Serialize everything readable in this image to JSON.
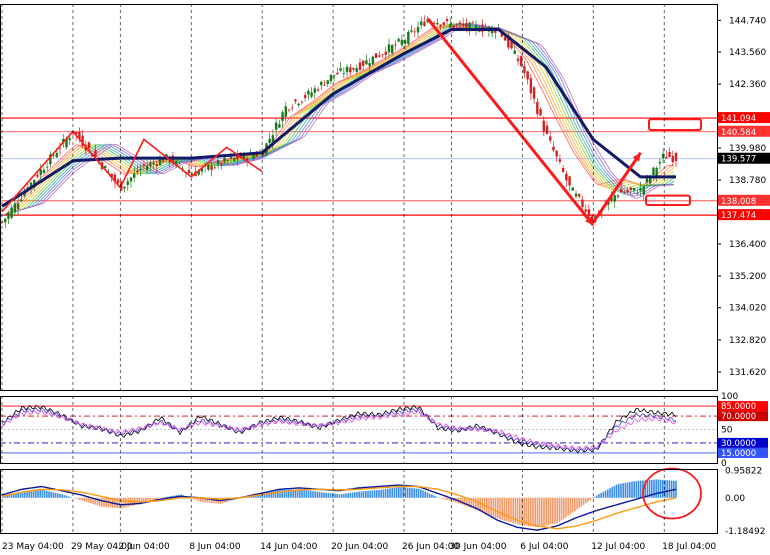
{
  "chart_data": [
    {
      "type": "line",
      "panel": "price",
      "title": "",
      "xlabel": "",
      "ylabel": "",
      "ylim": [
        130.95,
        145.35
      ],
      "y_ticks": [
        "144.740",
        "143.560",
        "142.360",
        "139.980",
        "138.780",
        "136.400",
        "135.200",
        "134.020",
        "132.820",
        "131.620"
      ],
      "price_marker": "139.577",
      "levels": [
        {
          "value": 141.094,
          "label": "141.094",
          "color": "#ff0000"
        },
        {
          "value": 140.584,
          "label": "140.584",
          "color": "#ff3030"
        },
        {
          "value": 138.008,
          "label": "138.008",
          "color": "#ff3030"
        },
        {
          "value": 137.474,
          "label": "137.474",
          "color": "#ff0000"
        }
      ],
      "close_series": [
        {
          "x": "23 May",
          "y": 137.2
        },
        {
          "x": "26 May",
          "y": 139.0
        },
        {
          "x": "29 May",
          "y": 140.6
        },
        {
          "x": "31 May",
          "y": 139.6
        },
        {
          "x": "2 Jun",
          "y": 138.5
        },
        {
          "x": "4 Jun",
          "y": 139.3
        },
        {
          "x": "6 Jun",
          "y": 139.6
        },
        {
          "x": "8 Jun",
          "y": 139.0
        },
        {
          "x": "11 Jun",
          "y": 139.5
        },
        {
          "x": "14 Jun",
          "y": 139.8
        },
        {
          "x": "16 Jun",
          "y": 141.5
        },
        {
          "x": "18 Jun",
          "y": 142.0
        },
        {
          "x": "20 Jun",
          "y": 142.7
        },
        {
          "x": "22 Jun",
          "y": 143.0
        },
        {
          "x": "26 Jun",
          "y": 144.0
        },
        {
          "x": "28 Jun",
          "y": 144.8
        },
        {
          "x": "30 Jun",
          "y": 144.55
        },
        {
          "x": "4 Jul",
          "y": 144.4
        },
        {
          "x": "6 Jul",
          "y": 143.0
        },
        {
          "x": "8 Jul",
          "y": 140.5
        },
        {
          "x": "10 Jul",
          "y": 138.5
        },
        {
          "x": "12 Jul",
          "y": 137.3
        },
        {
          "x": "14 Jul",
          "y": 138.3
        },
        {
          "x": "16 Jul",
          "y": 138.4
        },
        {
          "x": "18 Jul",
          "y": 139.7
        },
        {
          "x": "19 Jul",
          "y": 139.6
        }
      ],
      "ma_series": [
        {
          "x": "23 May",
          "y": 137.8
        },
        {
          "x": "29 May",
          "y": 139.5
        },
        {
          "x": "2 Jun",
          "y": 139.6
        },
        {
          "x": "8 Jun",
          "y": 139.6
        },
        {
          "x": "14 Jun",
          "y": 139.8
        },
        {
          "x": "20 Jun",
          "y": 142.0
        },
        {
          "x": "26 Jun",
          "y": 143.5
        },
        {
          "x": "30 Jun",
          "y": 144.4
        },
        {
          "x": "4 Jul",
          "y": 144.4
        },
        {
          "x": "8 Jul",
          "y": 143.0
        },
        {
          "x": "12 Jul",
          "y": 140.3
        },
        {
          "x": "16 Jul",
          "y": 138.9
        },
        {
          "x": "19 Jul",
          "y": 138.9
        }
      ]
    },
    {
      "type": "line",
      "panel": "oscillator",
      "title": "",
      "ylim": [
        0,
        100
      ],
      "levels": [
        {
          "value": 85,
          "label": "85.0000",
          "color": "#ff0000"
        },
        {
          "value": 70,
          "label": "70.0000",
          "color": "#cc0000"
        },
        {
          "value": 30,
          "label": "30.0000",
          "color": "#0000cc"
        },
        {
          "value": 15,
          "label": "15.0000",
          "color": "#3355ff"
        }
      ],
      "y_ticks": [
        "100",
        "50",
        "0"
      ],
      "series": [
        {
          "values": [
            60,
            82,
            84,
            72,
            55,
            52,
            40,
            48,
            68,
            45,
            70,
            58,
            45,
            60,
            68,
            62,
            52,
            64,
            74,
            72,
            80,
            84,
            52,
            48,
            56,
            44,
            30,
            24,
            22,
            18,
            20,
            62,
            80,
            75,
            72
          ]
        },
        {
          "values": [
            58,
            78,
            80,
            70,
            57,
            50,
            44,
            50,
            62,
            48,
            64,
            56,
            48,
            58,
            64,
            60,
            55,
            62,
            70,
            70,
            76,
            80,
            56,
            50,
            52,
            46,
            34,
            28,
            24,
            20,
            22,
            55,
            72,
            70,
            64
          ]
        },
        {
          "values": [
            56,
            74,
            76,
            68,
            58,
            52,
            46,
            52,
            60,
            50,
            60,
            55,
            50,
            56,
            62,
            58,
            56,
            60,
            66,
            68,
            72,
            76,
            58,
            52,
            50,
            48,
            38,
            30,
            26,
            22,
            24,
            48,
            64,
            66,
            60
          ]
        }
      ]
    },
    {
      "type": "bar",
      "panel": "macd",
      "title": "",
      "ylim": [
        -1.25,
        1.02
      ],
      "y_ticks": [
        "0.95822",
        "0.00",
        "-1.18492"
      ],
      "histogram": [
        0.05,
        0.18,
        0.28,
        0.12,
        -0.1,
        -0.32,
        -0.38,
        -0.2,
        0.0,
        0.12,
        -0.15,
        -0.22,
        0.0,
        0.15,
        0.28,
        0.3,
        0.2,
        0.12,
        0.22,
        0.28,
        0.38,
        0.32,
        0.0,
        -0.2,
        -0.45,
        -0.75,
        -0.95,
        -1.05,
        -0.9,
        -0.4,
        0.1,
        0.48,
        0.6,
        0.65,
        0.6
      ],
      "series": [
        {
          "values": [
            0.1,
            0.3,
            0.4,
            0.25,
            0.1,
            -0.1,
            -0.25,
            -0.2,
            -0.05,
            0.05,
            0.0,
            -0.1,
            0.0,
            0.15,
            0.3,
            0.35,
            0.3,
            0.25,
            0.35,
            0.4,
            0.45,
            0.4,
            0.15,
            -0.1,
            -0.4,
            -0.8,
            -1.05,
            -1.15,
            -1.0,
            -0.7,
            -0.45,
            -0.25,
            -0.05,
            0.15,
            0.3
          ]
        },
        {
          "values": [
            0.05,
            0.2,
            0.3,
            0.28,
            0.2,
            0.05,
            -0.1,
            -0.15,
            -0.1,
            0.0,
            0.0,
            -0.05,
            0.0,
            0.1,
            0.2,
            0.28,
            0.3,
            0.28,
            0.3,
            0.35,
            0.4,
            0.4,
            0.3,
            0.1,
            -0.15,
            -0.5,
            -0.8,
            -1.0,
            -1.1,
            -1.0,
            -0.8,
            -0.55,
            -0.35,
            -0.15,
            0.0
          ]
        }
      ]
    }
  ],
  "x_axis": {
    "labels": [
      "23 May 04:00",
      "29 May 04:00",
      "2 Jun 04:00",
      "8 Jun 04:00",
      "14 Jun 04:00",
      "20 Jun 04:00",
      "26 Jun 04:00",
      "30 Jun 04:00",
      "6 Jul 04:00",
      "12 Jul 04:00",
      "18 Jul 04:00"
    ]
  },
  "colors": {
    "up": "#1a7a1a",
    "down": "#d42020",
    "ma": "#101a66",
    "annotation": "#ff1a1a",
    "hist_pos": "#3c8ee8",
    "hist_neg": "#f39a6a",
    "macd_line": "#0a1a99",
    "signal_line": "#ff9a10"
  }
}
